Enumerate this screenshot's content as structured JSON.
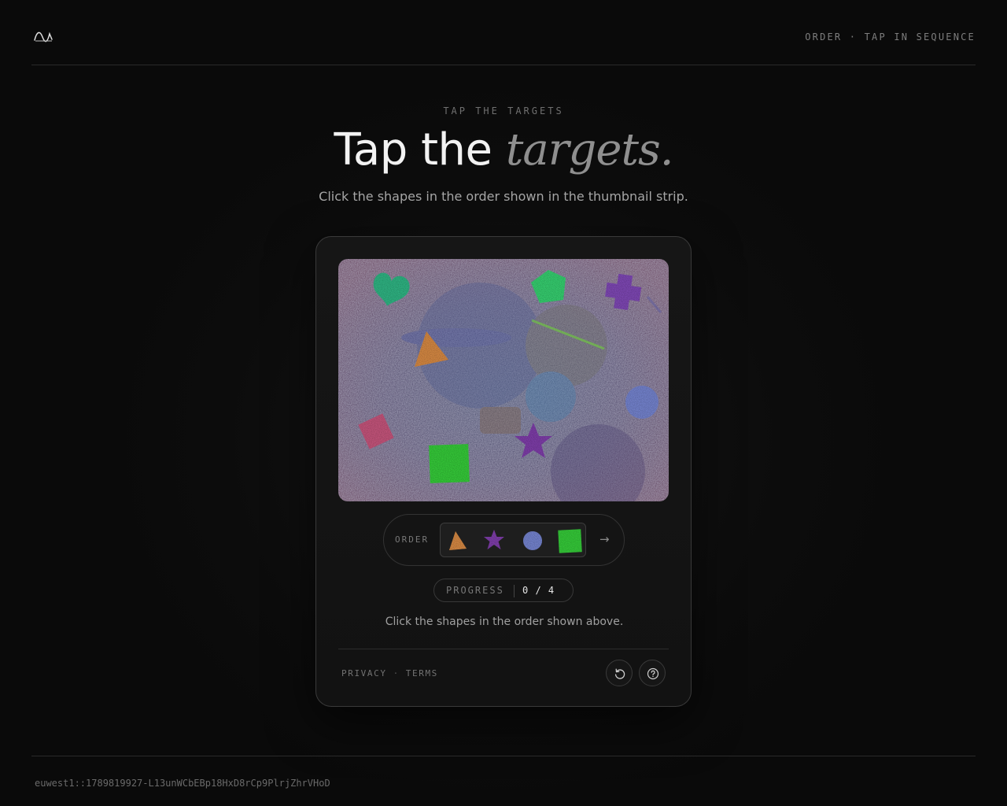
{
  "header": {
    "tagline": "ORDER · TAP IN SEQUENCE",
    "logo_icon": "wave-logo-icon"
  },
  "hero": {
    "eyebrow": "TAP THE TARGETS",
    "title_plain": "Tap the",
    "title_emphasis": "targets.",
    "subtitle": "Click the shapes in the order shown in the thumbnail strip."
  },
  "challenge": {
    "canvas_shapes": [
      {
        "shape": "heart",
        "color": "#35c48f"
      },
      {
        "shape": "pentagon",
        "color": "#3ce07a"
      },
      {
        "shape": "cross",
        "color": "#8a4fc4"
      },
      {
        "shape": "triangle",
        "color": "#e8954a"
      },
      {
        "shape": "circle",
        "color": "#7f8fe0"
      },
      {
        "shape": "diamond",
        "color": "#d65d87"
      },
      {
        "shape": "square",
        "color": "#3bdc3f"
      },
      {
        "shape": "star",
        "color": "#8a44b8"
      }
    ],
    "order_label": "ORDER",
    "order": [
      {
        "shape": "triangle",
        "color": "#e8954a"
      },
      {
        "shape": "star",
        "color": "#8a44b8"
      },
      {
        "shape": "circle",
        "color": "#7f8fe0"
      },
      {
        "shape": "square",
        "color": "#3bdc3f"
      }
    ],
    "next_arrow": "→",
    "progress_label": "PROGRESS",
    "progress_value": "0 / 4",
    "instruction": "Click the shapes in the order shown above."
  },
  "card_footer": {
    "privacy": "PRIVACY",
    "separator": "·",
    "terms": "TERMS",
    "reload_icon": "reload-icon",
    "help_icon": "help-icon"
  },
  "footer": {
    "session_id": "euwest1::1789819927-L13unWCbEBp18HxD8rCp9PlrjZhrVHoD"
  },
  "colors": {
    "background": "#0b0b0b",
    "text_primary": "#f2f2f2",
    "text_muted": "#8f8f8f"
  }
}
